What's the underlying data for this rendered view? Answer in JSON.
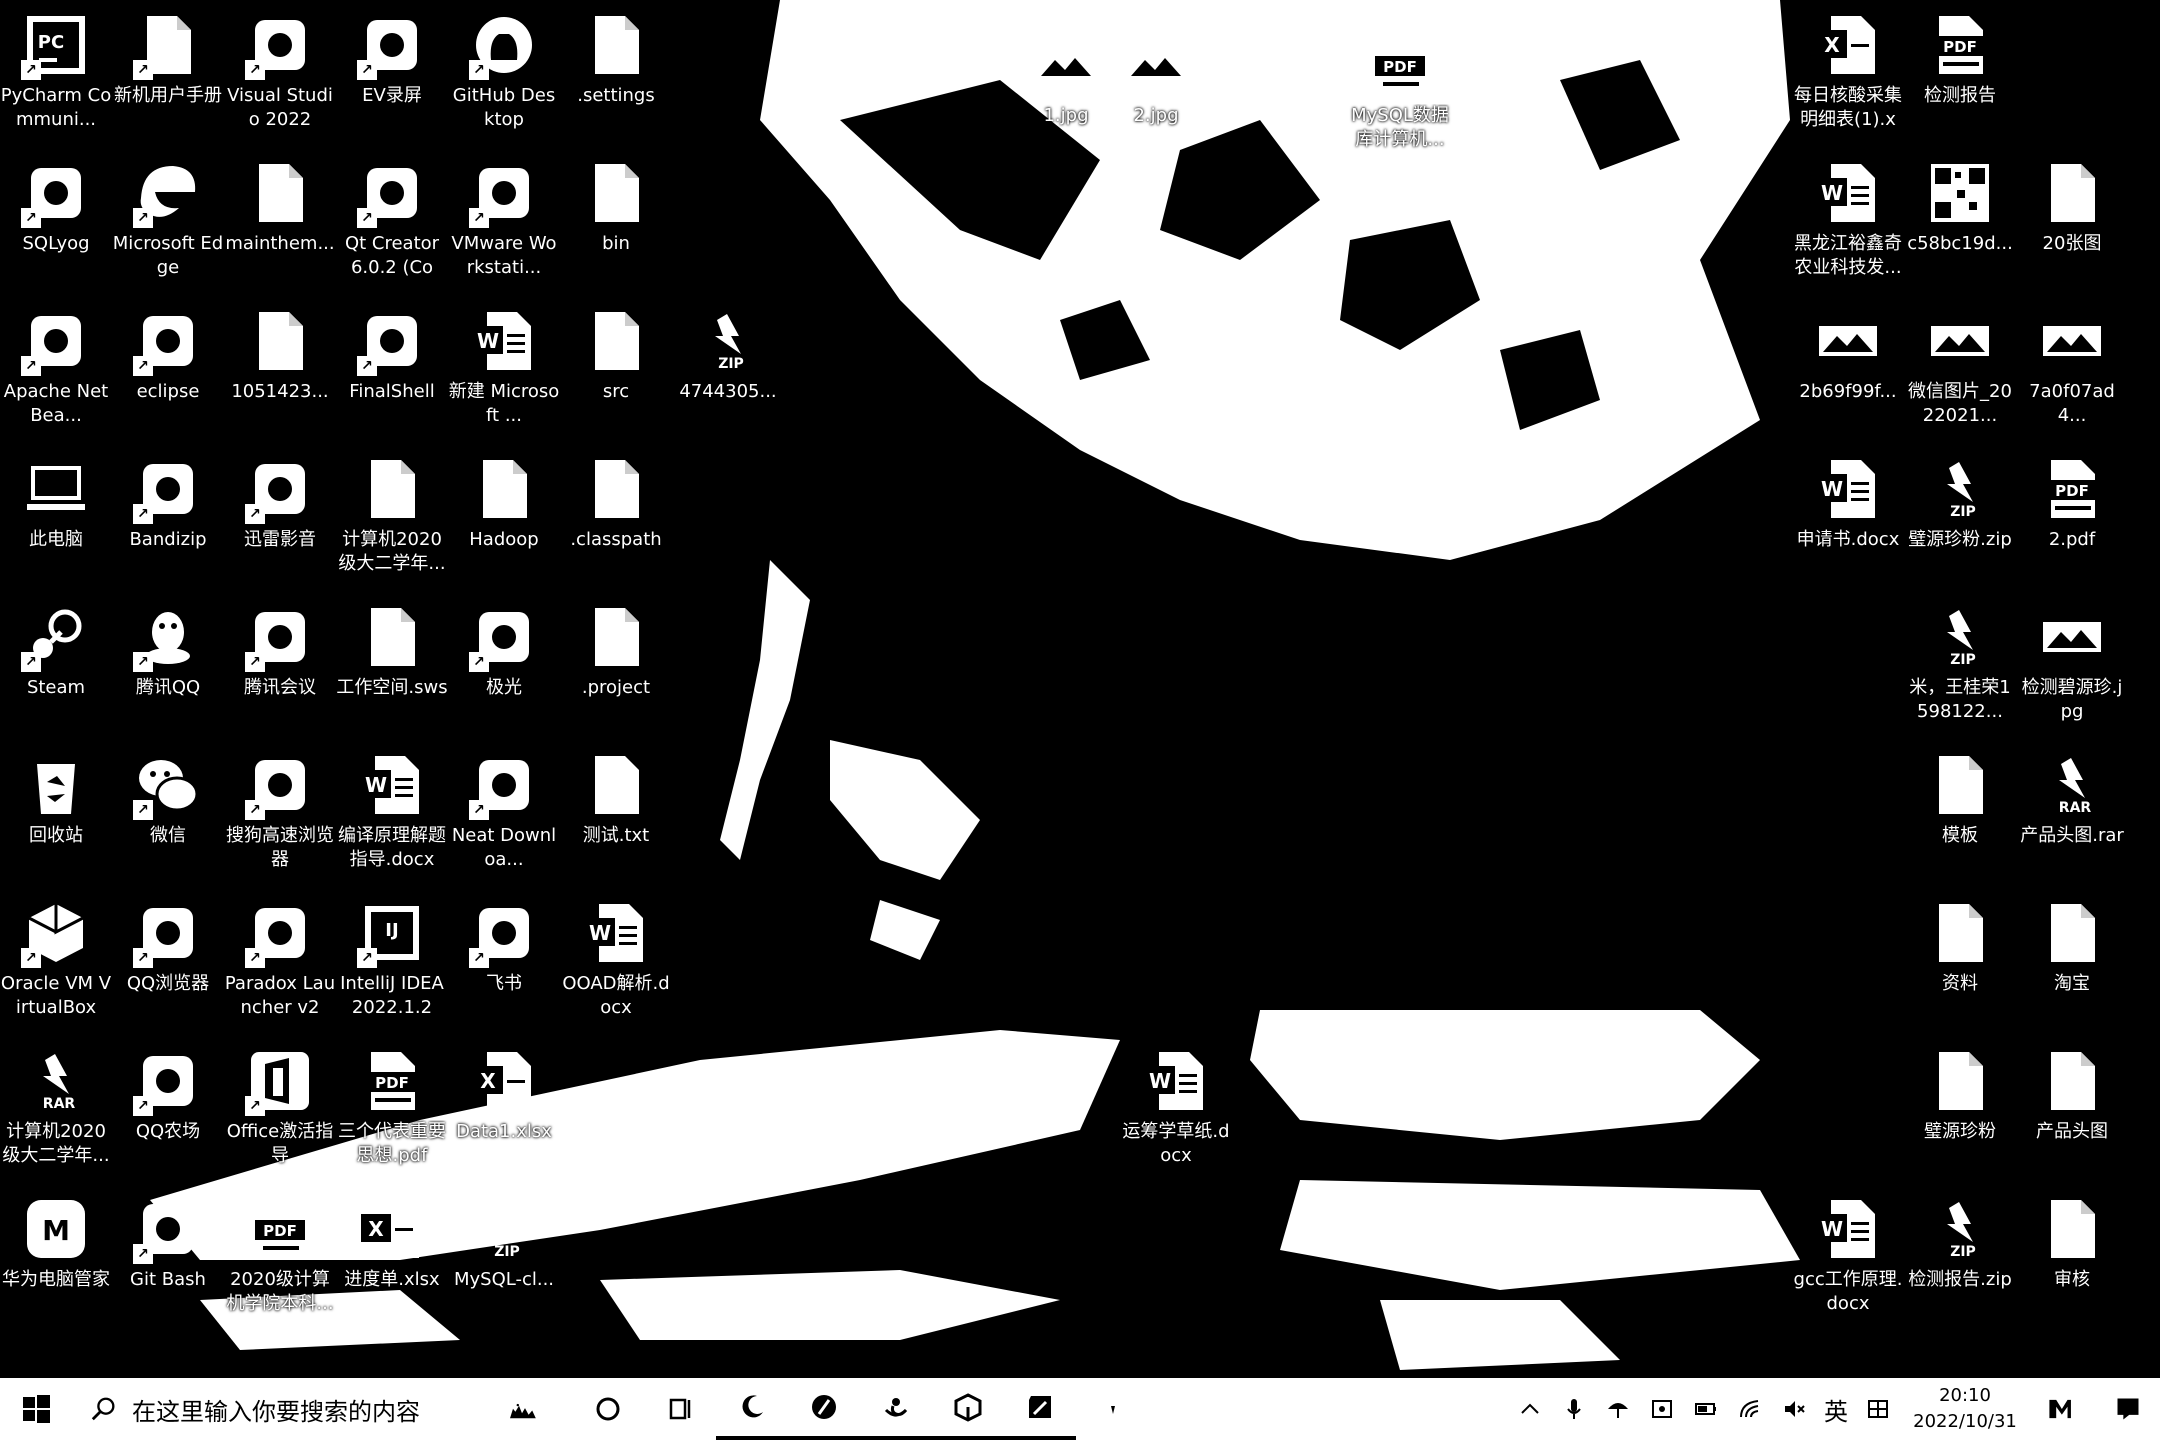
{
  "desktop": {
    "icons_left": [
      {
        "label": "PyCharm Communi...",
        "icon": "pycharm-icon"
      },
      {
        "label": "新机用户手册",
        "icon": "document-icon"
      },
      {
        "label": "Visual Studio 2022",
        "icon": "visual-studio-icon"
      },
      {
        "label": "EV录屏",
        "icon": "ev-recorder-icon"
      },
      {
        "label": "GitHub Desktop",
        "icon": "github-icon"
      },
      {
        "label": ".settings",
        "icon": "folder-icon"
      },
      {
        "label": "SQLyog",
        "icon": "sqlyog-icon"
      },
      {
        "label": "Microsoft Edge",
        "icon": "edge-icon"
      },
      {
        "label": "mainthem...",
        "icon": "file-icon"
      },
      {
        "label": "Qt Creator 6.0.2 (Com...",
        "icon": "qt-creator-icon"
      },
      {
        "label": "VMware Workstati...",
        "icon": "vmware-icon"
      },
      {
        "label": "bin",
        "icon": "folder-icon"
      },
      {
        "label": "Apache NetBea...",
        "icon": "netbeans-icon"
      },
      {
        "label": "eclipse",
        "icon": "eclipse-icon"
      },
      {
        "label": "1051423...",
        "icon": "file-icon"
      },
      {
        "label": "FinalShell",
        "icon": "finalshell-icon"
      },
      {
        "label": "新建 Microsoft ...",
        "icon": "word-icon"
      },
      {
        "label": "src",
        "icon": "folder-icon"
      },
      {
        "label": "4744305...",
        "icon": "zip-icon"
      },
      {
        "label": "此电脑",
        "icon": "this-pc-icon"
      },
      {
        "label": "Bandizip",
        "icon": "bandizip-icon"
      },
      {
        "label": "迅雷影音",
        "icon": "thunder-player-icon"
      },
      {
        "label": "计算机2020级大二学年...",
        "icon": "folder-icon"
      },
      {
        "label": "Hadoop",
        "icon": "folder-icon"
      },
      {
        "label": ".classpath",
        "icon": "file-icon"
      },
      {
        "label": "Steam",
        "icon": "steam-icon"
      },
      {
        "label": "腾讯QQ",
        "icon": "qq-icon"
      },
      {
        "label": "腾讯会议",
        "icon": "tencent-meeting-icon"
      },
      {
        "label": "工作空间.sws",
        "icon": "file-icon"
      },
      {
        "label": "极光",
        "icon": "jiguang-icon"
      },
      {
        "label": ".project",
        "icon": "file-icon"
      },
      {
        "label": "回收站",
        "icon": "recycle-bin-icon"
      },
      {
        "label": "微信",
        "icon": "wechat-icon"
      },
      {
        "label": "搜狗高速浏览器",
        "icon": "sogou-browser-icon"
      },
      {
        "label": "编译原理解题指导.docx",
        "icon": "word-icon"
      },
      {
        "label": "Neat Downloa...",
        "icon": "neat-download-icon"
      },
      {
        "label": "测试.txt",
        "icon": "text-file-icon"
      },
      {
        "label": "Oracle VM VirtualBox",
        "icon": "virtualbox-icon"
      },
      {
        "label": "QQ浏览器",
        "icon": "qq-browser-icon"
      },
      {
        "label": "Paradox Launcher v2",
        "icon": "paradox-icon"
      },
      {
        "label": "IntelliJ IDEA 2022.1.2",
        "icon": "intellij-icon"
      },
      {
        "label": "飞书",
        "icon": "feishu-icon"
      },
      {
        "label": "OOAD解析.docx",
        "icon": "word-icon"
      },
      {
        "label": "计算机2020级大二学年...",
        "icon": "rar-icon"
      },
      {
        "label": "QQ农场",
        "icon": "qq-farm-icon"
      },
      {
        "label": "Office激活指导",
        "icon": "office-icon"
      },
      {
        "label": "三个代表重要思想.pdf",
        "icon": "pdf-icon"
      },
      {
        "label": "Data1.xlsx",
        "icon": "excel-icon"
      },
      {
        "label": "华为电脑管家",
        "icon": "huawei-manager-icon"
      },
      {
        "label": "Git Bash",
        "icon": "git-bash-icon"
      },
      {
        "label": "2020级计算机学院本科...",
        "icon": "pdf-icon"
      },
      {
        "label": "进度单.xlsx",
        "icon": "excel-icon"
      },
      {
        "label": "MySQL-cl...",
        "icon": "zip-icon"
      }
    ],
    "icons_middle": [
      {
        "label": "1.jpg",
        "icon": "image-icon"
      },
      {
        "label": "2.jpg",
        "icon": "image-icon"
      },
      {
        "label": "MySQL数据库计算机...",
        "icon": "pdf-icon"
      },
      {
        "label": "运筹学草纸.docx",
        "icon": "word-icon"
      }
    ],
    "icons_right": [
      {
        "label": "每日核酸采集明细表(1).xl...",
        "icon": "excel-icon"
      },
      {
        "label": "检测报告",
        "icon": "pdf-icon"
      },
      {
        "label": "黑龙江裕鑫奇农业科技发...",
        "icon": "word-icon"
      },
      {
        "label": "c58bc19d...",
        "icon": "qr-image-icon"
      },
      {
        "label": "20张图",
        "icon": "folder-icon"
      },
      {
        "label": "2b69f99f...",
        "icon": "image-icon"
      },
      {
        "label": "微信图片_2022021...",
        "icon": "image-icon"
      },
      {
        "label": "7a0f07ad4...",
        "icon": "image-icon"
      },
      {
        "label": "申请书.docx",
        "icon": "word-icon"
      },
      {
        "label": "璧源珍粉.zip",
        "icon": "zip-icon"
      },
      {
        "label": "2.pdf",
        "icon": "pdf-icon"
      },
      {
        "label": "米，王桂荣1598122...",
        "icon": "zip-icon"
      },
      {
        "label": "检测碧源珍.jpg",
        "icon": "image-icon"
      },
      {
        "label": "模板",
        "icon": "folder-icon"
      },
      {
        "label": "产品头图.rar",
        "icon": "rar-icon"
      },
      {
        "label": "资料",
        "icon": "folder-icon"
      },
      {
        "label": "淘宝",
        "icon": "folder-icon"
      },
      {
        "label": "璧源珍粉",
        "icon": "folder-icon"
      },
      {
        "label": "产品头图",
        "icon": "folder-icon"
      },
      {
        "label": "gcc工作原理.docx",
        "icon": "word-icon"
      },
      {
        "label": "检测报告.zip",
        "icon": "zip-icon"
      },
      {
        "label": "审核",
        "icon": "folder-icon"
      }
    ]
  },
  "taskbar": {
    "search_placeholder": "在这里输入你要搜索的内容",
    "ime_lang": "英",
    "clock_time": "20:10",
    "clock_date": "2022/10/31"
  }
}
